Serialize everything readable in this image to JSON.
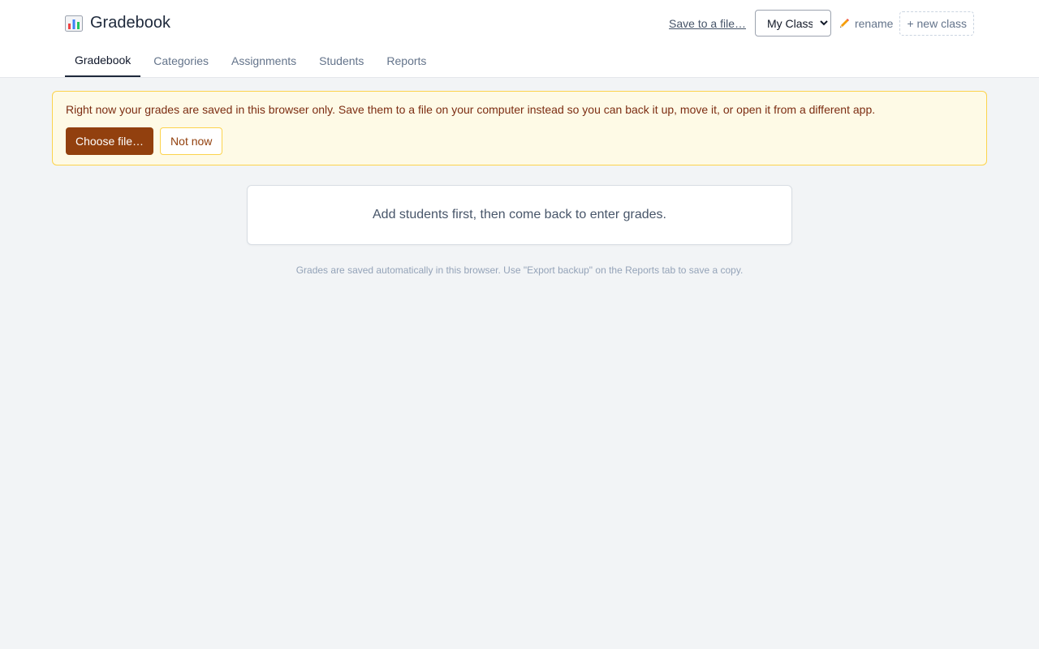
{
  "app": {
    "title": "Gradebook"
  },
  "header": {
    "save_link": "Save to a file…",
    "class_select": {
      "selected": "My Class",
      "options": [
        "My Class"
      ]
    },
    "rename_label": "rename",
    "new_class_label": "+ new class"
  },
  "tabs": [
    {
      "label": "Gradebook",
      "active": true
    },
    {
      "label": "Categories",
      "active": false
    },
    {
      "label": "Assignments",
      "active": false
    },
    {
      "label": "Students",
      "active": false
    },
    {
      "label": "Reports",
      "active": false
    }
  ],
  "banner": {
    "message": "Right now your grades are saved in this browser only. Save them to a file on your computer instead so you can back it up, move it, or open it from a different app.",
    "primary_label": "Choose file…",
    "secondary_label": "Not now"
  },
  "main": {
    "empty_message": "Add students first, then come back to enter grades."
  },
  "footer": {
    "note": "Grades are saved automatically in this browser. Use \"Export backup\" on the Reports tab to save a copy."
  },
  "colors": {
    "accent": "#92400e",
    "banner_bg": "#fefae6",
    "banner_border": "#fcd34d",
    "page_bg": "#f2f4f6"
  },
  "icons": {
    "brand": "bar-chart-icon",
    "rename": "pencil-icon"
  }
}
